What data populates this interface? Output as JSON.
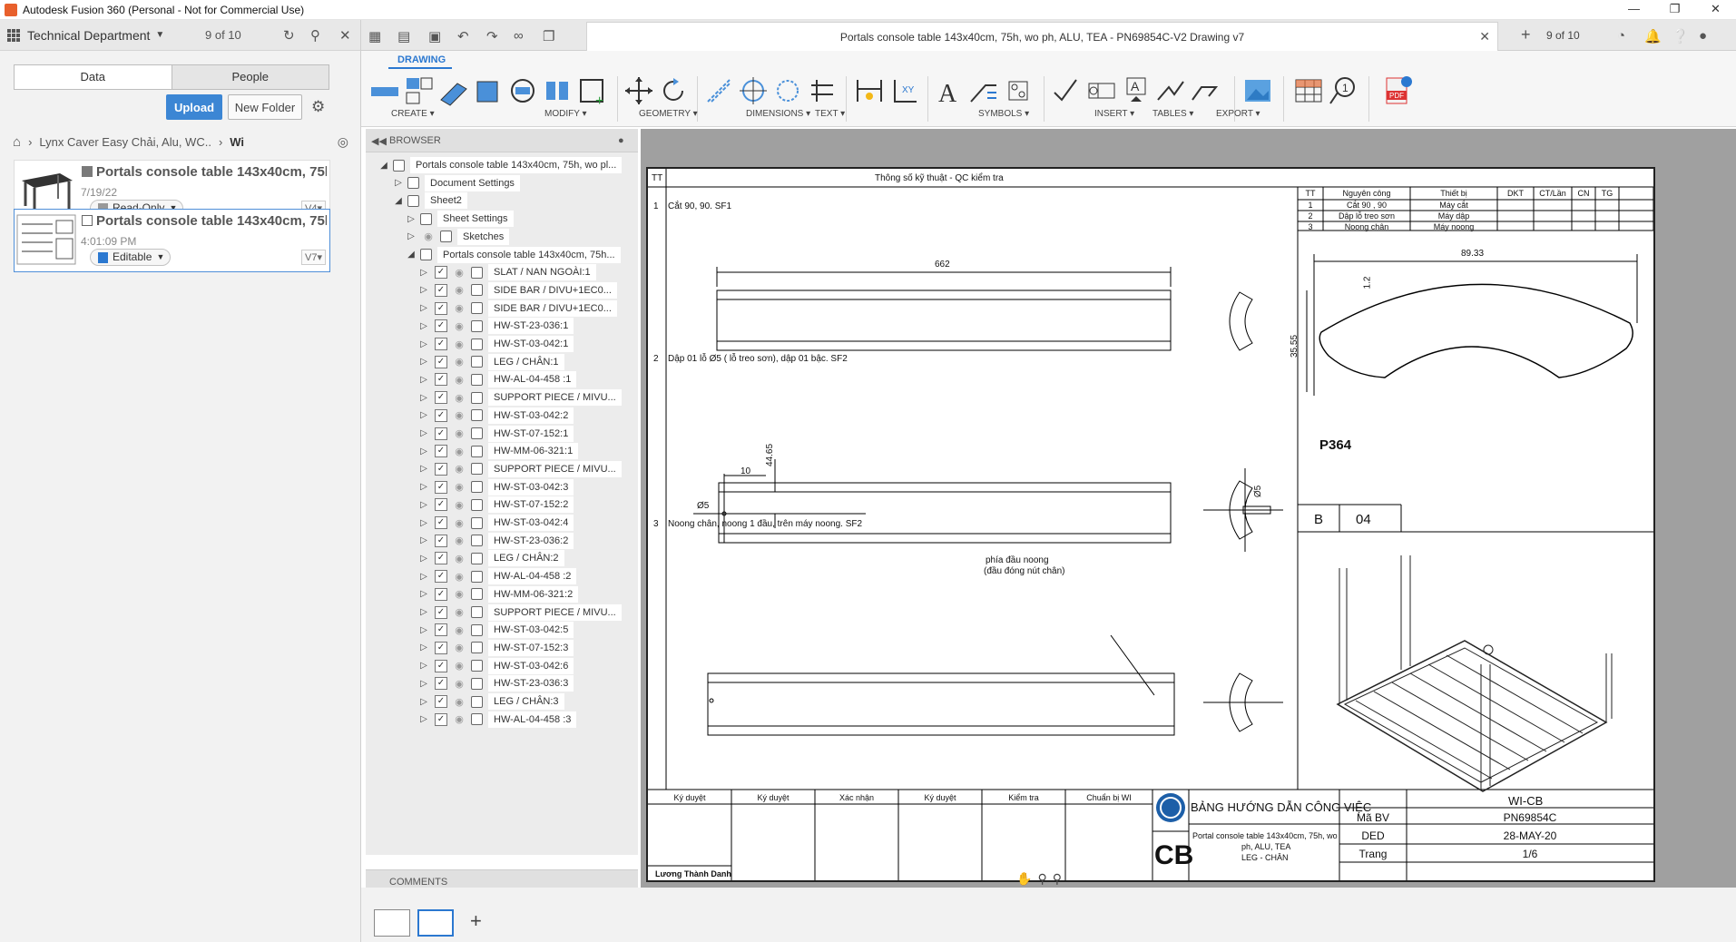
{
  "window": {
    "title": "Autodesk Fusion 360 (Personal - Not for Commercial Use)"
  },
  "data_panel": {
    "team": "Technical Department",
    "version_count": "9 of 10",
    "tabs": [
      "Data",
      "People"
    ],
    "upload": "Upload",
    "new_folder": "New Folder",
    "breadcrumb": [
      "Lynx Caver Easy Chải, Alu, WC..",
      "Wi"
    ],
    "files": [
      {
        "name": "Portals console table 143x40cm, 75h, ...",
        "date": "7/19/22",
        "status": "Read-Only",
        "version": "V4"
      },
      {
        "name": "Portals console table 143x40cm, 75h, ...",
        "date": "4:01:09 PM",
        "status": "Editable",
        "version": "V7"
      }
    ]
  },
  "document": {
    "tab_title": "Portals console table 143x40cm, 75h, wo ph, ALU, TEA - PN69854C-V2 Drawing v7",
    "version_count": "9 of 10"
  },
  "ribbon": {
    "active_tab": "DRAWING",
    "groups": [
      "CREATE",
      "MODIFY",
      "GEOMETRY",
      "DIMENSIONS",
      "TEXT",
      "SYMBOLS",
      "INSERT",
      "TABLES",
      "EXPORT"
    ]
  },
  "browser": {
    "title": "BROWSER",
    "comments": "COMMENTS",
    "root": "Portals console table 143x40cm, 75h, wo pl...",
    "document_settings": "Document Settings",
    "sheet": "Sheet2",
    "sheet_settings": "Sheet Settings",
    "sketches": "Sketches",
    "component": "Portals console table 143x40cm, 75h...",
    "items": [
      "SLAT / NAN NGOÀI:1",
      "SIDE BAR / DIVU+1EC0...",
      "SIDE BAR / DIVU+1EC0...",
      "HW-ST-23-036:1",
      "HW-ST-03-042:1",
      "LEG / CHÂN:1",
      "HW-AL-04-458 :1",
      "SUPPORT PIECE / MIVU...",
      "HW-ST-03-042:2",
      "HW-ST-07-152:1",
      "HW-MM-06-321:1",
      "SUPPORT PIECE / MIVU...",
      "HW-ST-03-042:3",
      "HW-ST-07-152:2",
      "HW-ST-03-042:4",
      "HW-ST-23-036:2",
      "LEG / CHÂN:2",
      "HW-AL-04-458 :2",
      "HW-MM-06-321:2",
      "SUPPORT PIECE / MIVU...",
      "HW-ST-03-042:5",
      "HW-ST-07-152:3",
      "HW-ST-03-042:6",
      "HW-ST-23-036:3",
      "LEG / CHÂN:3",
      "HW-AL-04-458 :3"
    ]
  },
  "drawing": {
    "header_tt": "TT",
    "header_title": "Thông số kỹ thuật - QC kiểm tra",
    "steps": [
      {
        "no": "1",
        "text": "Cắt 90, 90. SF1"
      },
      {
        "no": "2",
        "text": "Dập 01 lỗ Ø5 ( lỗ treo sơn), dập 01 bậc. SF2"
      },
      {
        "no": "3",
        "text": "Noong chân, noong 1 đầu, trên máy noong. SF2"
      }
    ],
    "dims": {
      "d1": "662",
      "d2": "10",
      "d3": "44.65",
      "d4": "Ø5",
      "d5": "Ø5",
      "d6": "89.33",
      "d7": "1.2",
      "d8": "35.55"
    },
    "note": [
      "phía đầu noong",
      "(đầu đóng nút chân)"
    ],
    "process_table": {
      "headers": [
        "TT",
        "Nguyên công",
        "Thiết bị",
        "DKT",
        "CT/Lần",
        "CN",
        "TG"
      ],
      "rows": [
        [
          "1",
          "Cắt 90 , 90",
          "Máy cắt"
        ],
        [
          "2",
          "Dập lỗ treo sơn",
          "Máy dập"
        ],
        [
          "3",
          "Noong chân",
          "Máy noong"
        ]
      ]
    },
    "part_code": "P364",
    "rev_letter": "B",
    "rev_no": "04",
    "signatures": [
      "Ký duyệt",
      "Ký duyệt",
      "Xác nhận",
      "Ký duyệt",
      "Kiểm tra",
      "Chuẩn bị WI"
    ],
    "prepared_by": "Lương Thành Danh",
    "company_logo": "CB",
    "sheet_title": "BẢNG HƯỚNG DẪN CÔNG VIỆC",
    "part_desc": [
      "Portal console table 143x40cm, 75h, wo",
      "ph, ALU, TEA",
      "LEG - CHÂN"
    ],
    "doc_type": "WI-CB",
    "fields": [
      {
        "label": "Mã BV",
        "value": "PN69854C"
      },
      {
        "label": "DED",
        "value": "28-MAY-20"
      },
      {
        "label": "Trang",
        "value": "1/6"
      }
    ]
  }
}
